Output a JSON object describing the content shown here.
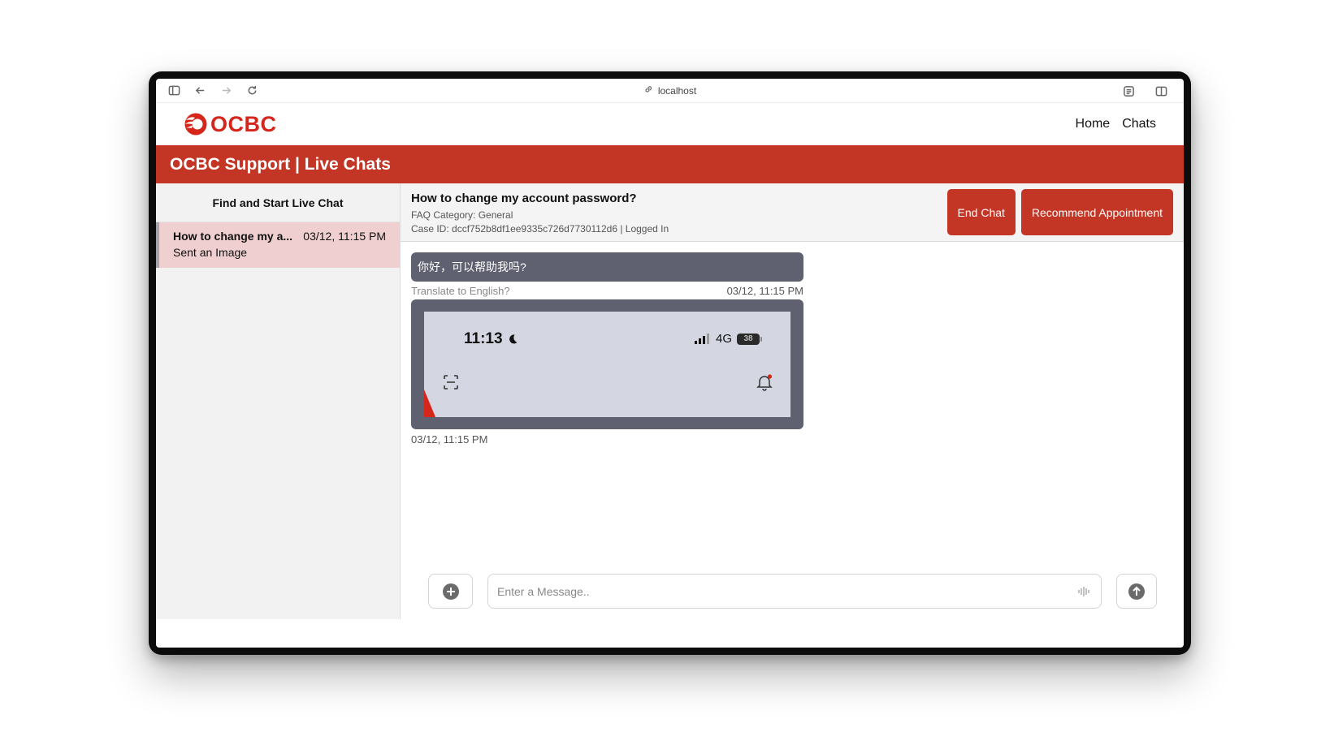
{
  "browser": {
    "url": "localhost"
  },
  "brand": {
    "logo_text": "OCBC",
    "accent": "#c33525"
  },
  "nav": {
    "home": "Home",
    "chats": "Chats"
  },
  "banner": {
    "title": "OCBC Support | Live Chats"
  },
  "sidebar": {
    "title": "Find and Start Live Chat",
    "items": [
      {
        "subject": "How to change my a...",
        "time": "03/12, 11:15 PM",
        "preview": "Sent an Image"
      }
    ]
  },
  "chat_header": {
    "question": "How to change my account password?",
    "category": "FAQ Category: General",
    "case": "Case ID: dccf752b8df1ee9335c726d7730112d6 | Logged In",
    "end_chat": "End Chat",
    "recommend": "Recommend Appointment"
  },
  "messages": [
    {
      "text": "你好，可以帮助我吗?",
      "translate": "Translate to English?",
      "time": "03/12, 11:15 PM"
    },
    {
      "type": "image",
      "time": "03/12, 11:15 PM",
      "screenshot": {
        "clock": "11:13",
        "network": "4G",
        "battery": "38"
      }
    }
  ],
  "composer": {
    "placeholder": "Enter a Message.."
  },
  "icons": [
    "sidebar-toggle-icon",
    "back-arrow-icon",
    "forward-arrow-icon",
    "reload-icon",
    "link-icon",
    "reader-icon",
    "split-view-icon",
    "plus-icon",
    "mic-icon",
    "send-arrow-icon"
  ]
}
